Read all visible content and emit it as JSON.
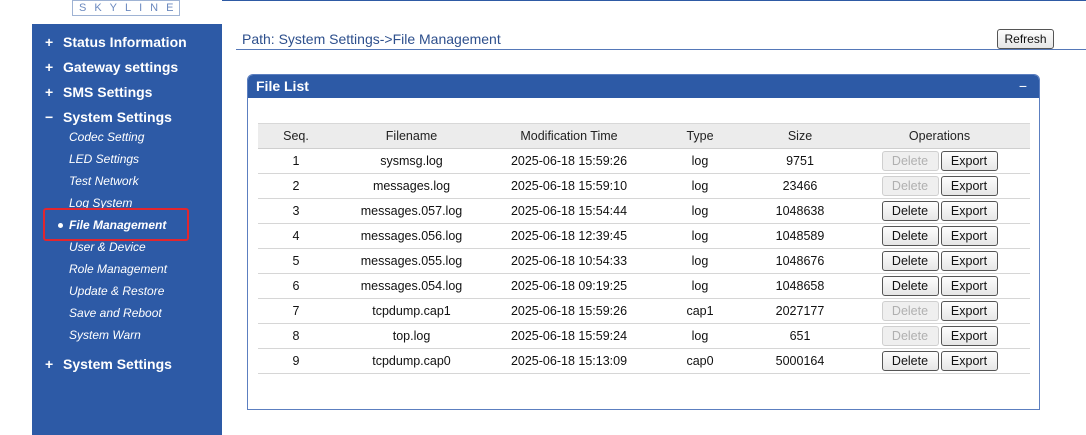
{
  "brand": {
    "logo_text": "SKYLINE"
  },
  "sidebar": {
    "groups": [
      {
        "sign": "+",
        "label": "Status Information"
      },
      {
        "sign": "+",
        "label": "Gateway settings"
      },
      {
        "sign": "+",
        "label": "SMS Settings"
      },
      {
        "sign": "−",
        "label": "System Settings"
      },
      {
        "sign": "+",
        "label": "System Settings"
      }
    ],
    "sub_items": [
      "Codec Setting",
      "LED Settings",
      "Test Network",
      "Log System",
      "File Management",
      "User & Device",
      "Role Management",
      "Update & Restore",
      "Save and Reboot",
      "System Warn"
    ],
    "active_sub_item": "File Management"
  },
  "main": {
    "path": "Path: System Settings->File Management",
    "refresh_label": "Refresh",
    "panel_title": "File List",
    "collapse_symbol": "−",
    "columns": [
      "Seq.",
      "Filename",
      "Modification Time",
      "Type",
      "Size",
      "Operations"
    ],
    "delete_label": "Delete",
    "export_label": "Export",
    "rows": [
      {
        "seq": "1",
        "filename": "sysmsg.log",
        "time": "2025-06-18 15:59:26",
        "type": "log",
        "size": "9751",
        "delete_enabled": false
      },
      {
        "seq": "2",
        "filename": "messages.log",
        "time": "2025-06-18 15:59:10",
        "type": "log",
        "size": "23466",
        "delete_enabled": false
      },
      {
        "seq": "3",
        "filename": "messages.057.log",
        "time": "2025-06-18 15:54:44",
        "type": "log",
        "size": "1048638",
        "delete_enabled": true
      },
      {
        "seq": "4",
        "filename": "messages.056.log",
        "time": "2025-06-18 12:39:45",
        "type": "log",
        "size": "1048589",
        "delete_enabled": true
      },
      {
        "seq": "5",
        "filename": "messages.055.log",
        "time": "2025-06-18 10:54:33",
        "type": "log",
        "size": "1048676",
        "delete_enabled": true
      },
      {
        "seq": "6",
        "filename": "messages.054.log",
        "time": "2025-06-18 09:19:25",
        "type": "log",
        "size": "1048658",
        "delete_enabled": true
      },
      {
        "seq": "7",
        "filename": "tcpdump.cap1",
        "time": "2025-06-18 15:59:26",
        "type": "cap1",
        "size": "2027177",
        "delete_enabled": false
      },
      {
        "seq": "8",
        "filename": "top.log",
        "time": "2025-06-18 15:59:24",
        "type": "log",
        "size": "651",
        "delete_enabled": false
      },
      {
        "seq": "9",
        "filename": "tcpdump.cap0",
        "time": "2025-06-18 15:13:09",
        "type": "cap0",
        "size": "5000164",
        "delete_enabled": true
      }
    ]
  }
}
